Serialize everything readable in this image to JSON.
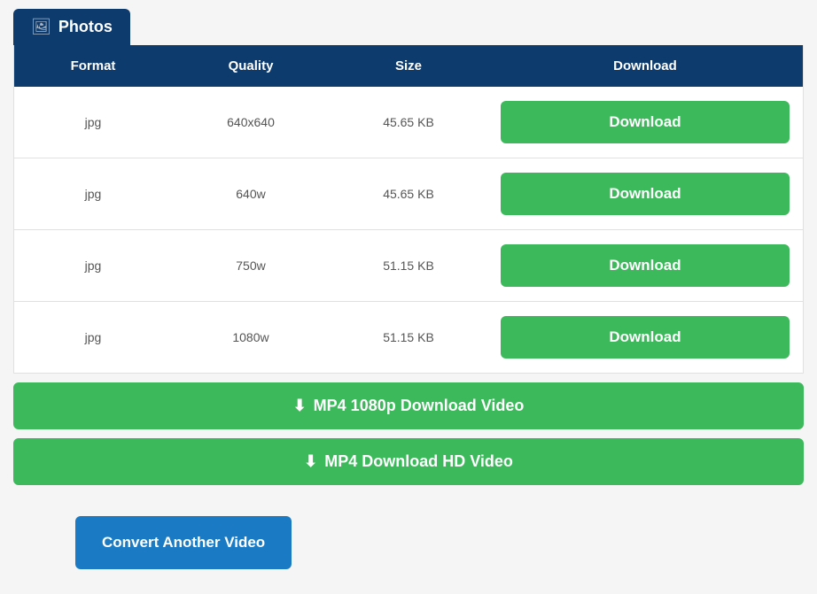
{
  "tab": {
    "icon": "🖼",
    "label": "Photos"
  },
  "table": {
    "headers": {
      "format": "Format",
      "quality": "Quality",
      "size": "Size",
      "download": "Download"
    },
    "rows": [
      {
        "format": "jpg",
        "quality": "640x640",
        "size": "45.65 KB",
        "download_label": "Download"
      },
      {
        "format": "jpg",
        "quality": "640w",
        "size": "45.65 KB",
        "download_label": "Download"
      },
      {
        "format": "jpg",
        "quality": "750w",
        "size": "51.15 KB",
        "download_label": "Download"
      },
      {
        "format": "jpg",
        "quality": "1080w",
        "size": "51.15 KB",
        "download_label": "Download"
      }
    ]
  },
  "big_buttons": {
    "mp4_1080p_label": "MP4 1080p Download Video",
    "mp4_hd_label": "MP4 Download HD Video"
  },
  "convert_button": {
    "label": "Convert Another Video"
  }
}
